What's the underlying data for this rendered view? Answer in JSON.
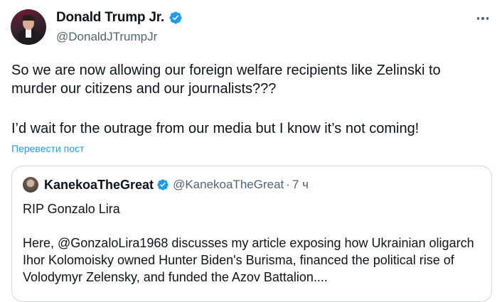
{
  "author": {
    "display_name": "Donald Trump Jr.",
    "handle": "@DonaldJTrumpJr",
    "verified": true
  },
  "tweet": {
    "line1": "So we are now allowing our foreign welfare recipients like Zelinski to",
    "line2": "murder our citizens and our journalists???",
    "line3": "I’d wait for the outrage from our media but I know it’s not coming!"
  },
  "translate_label": "Перевести пост",
  "quoted": {
    "display_name": "KanekoaTheGreat",
    "handle": "@KanekoaTheGreat",
    "separator": "·",
    "time": "7 ч",
    "verified": true,
    "line1": "RIP Gonzalo Lira",
    "line2": "Here, @GonzaloLira1968 discusses my article exposing how Ukrainian oligarch",
    "line3": "Ihor Kolomoisky owned Hunter Biden's Burisma, financed the political rise of",
    "line4": "Volodymyr Zelensky, and funded the Azov Battalion...."
  },
  "colors": {
    "verified_blue": "#1d9bf0",
    "link_blue": "#1d9bf0",
    "secondary_text": "#536471",
    "border": "#cfd9de"
  },
  "icons": [
    "verified-badge-icon",
    "more-options-icon"
  ]
}
